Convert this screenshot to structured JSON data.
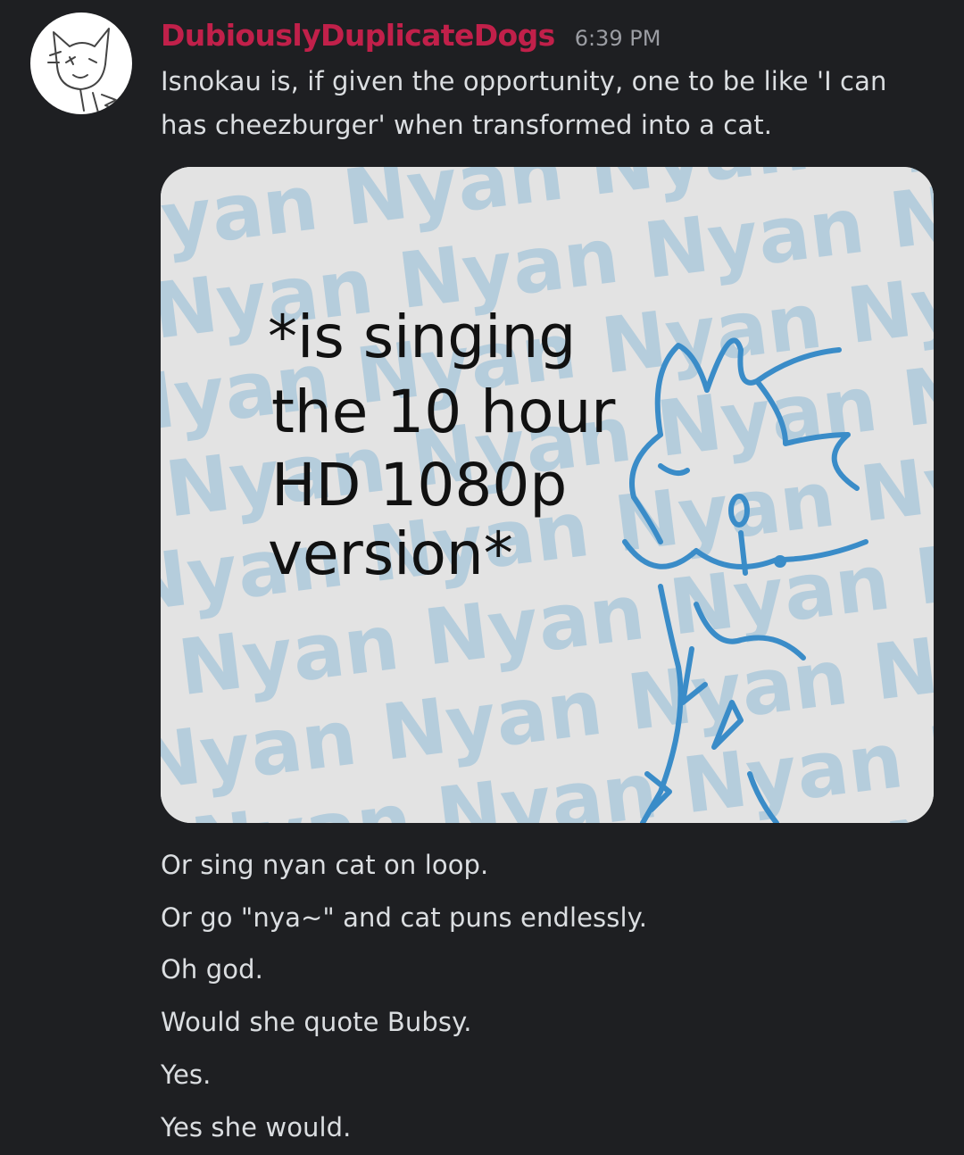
{
  "message": {
    "username": "DubiouslyDuplicateDogs",
    "username_color": "#c1204a",
    "timestamp": "6:39 PM",
    "lines": [
      "Isnokau is, if given the opportunity, one to be like 'I can",
      "has cheezburger' when transformed into a cat."
    ],
    "followups": [
      "Or sing nyan cat on loop.",
      "Or go \"nya~\" and cat puns endlessly.",
      "Oh god.",
      "Would she quote Bubsy.",
      "Yes.",
      "Yes she would."
    ]
  },
  "attachment": {
    "background_word": "Nyan",
    "caption_lines": [
      "*is singing",
      "the 10 hour",
      "HD 1080p",
      "version*"
    ],
    "sketch_color": "#3a8cc8",
    "background_text_color": "#b5cddc"
  },
  "avatar": {
    "icon": "sketch-cat-avatar-icon"
  }
}
